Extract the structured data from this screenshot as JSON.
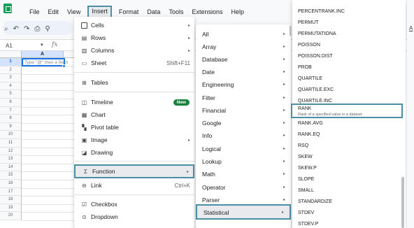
{
  "menubar": {
    "items": [
      "File",
      "Edit",
      "View",
      "Insert",
      "Format",
      "Data",
      "Tools",
      "Extensions",
      "Help"
    ],
    "active": "Insert"
  },
  "toolbar": {
    "icons": [
      "search-icon",
      "undo-icon",
      "redo-icon",
      "print-icon",
      "paint-format-icon"
    ],
    "glyphs": [
      "⌕",
      "↶",
      "↷",
      "⎙",
      "⚲"
    ],
    "right_label": "A"
  },
  "formula_bar": {
    "cell_ref": "A1",
    "dropdown_glyph": "▾",
    "fx_label": "fx"
  },
  "grid": {
    "column": "A",
    "rows": [
      "1",
      "2",
      "3",
      "4",
      "5",
      "6",
      "7",
      "8",
      "9",
      "10",
      "11",
      "12",
      "13",
      "14",
      "15",
      "16",
      "17",
      "18",
      "19",
      "20"
    ],
    "cell_hint": "Type \"@\" then a file n"
  },
  "insert_menu": {
    "items": [
      {
        "label": "Cells",
        "icon": "cells-icon",
        "glyph": "",
        "arrow": "▸"
      },
      {
        "label": "Rows",
        "icon": "rows-icon",
        "glyph": "▤",
        "arrow": "▸"
      },
      {
        "label": "Columns",
        "icon": "columns-icon",
        "glyph": "▥",
        "arrow": "▸"
      },
      {
        "label": "Sheet",
        "icon": "sheet-icon",
        "glyph": "▭",
        "shortcut": "Shift+F11"
      },
      {
        "label": "Tables",
        "icon": "tables-icon",
        "glyph": "⊞"
      },
      {
        "label": "Timeline",
        "icon": "timeline-icon",
        "glyph": "◫",
        "badge": "New"
      },
      {
        "label": "Chart",
        "icon": "chart-icon",
        "glyph": "▦"
      },
      {
        "label": "Pivot table",
        "icon": "pivot-table-icon",
        "glyph": "▚"
      },
      {
        "label": "Image",
        "icon": "image-icon",
        "glyph": "▣",
        "arrow": "▸"
      },
      {
        "label": "Drawing",
        "icon": "drawing-icon",
        "glyph": "◪"
      },
      {
        "label": "Function",
        "icon": "sigma-icon",
        "glyph": "Σ",
        "arrow": "▸"
      },
      {
        "label": "Link",
        "icon": "link-icon",
        "glyph": "⊖",
        "shortcut": "Ctrl+K"
      },
      {
        "label": "Checkbox",
        "icon": "checkbox-icon",
        "glyph": "☑"
      },
      {
        "label": "Dropdown",
        "icon": "dropdown-icon",
        "glyph": "⊙"
      }
    ],
    "highlighted": "Function"
  },
  "function_menu": {
    "items": [
      "All",
      "Array",
      "Database",
      "Date",
      "Engineering",
      "Filter",
      "Financial",
      "Google",
      "Info",
      "Logical",
      "Lookup",
      "Math",
      "Operator",
      "Parser",
      "Statistical"
    ],
    "arrow": "▸",
    "highlighted": "Statistical"
  },
  "statistical_menu": {
    "items": [
      "PERCENTRANK.INC",
      "PERMUT",
      "PERMUTATIONA",
      "POISSON",
      "POISSON.DIST",
      "PROB",
      "QUARTILE",
      "QUARTILE.EXC",
      "QUARTILE.INC",
      "RANK",
      "RANK.AVG",
      "RANK.EQ",
      "RSQ",
      "SKEW",
      "SKEW.P",
      "SLOPE",
      "SMALL",
      "STANDARDIZE",
      "STDEV",
      "STDEV.P"
    ],
    "highlighted": "RANK",
    "highlight_description": "Rank of a specified value in a dataset."
  },
  "colors": {
    "highlight_border": "#4a8fa3",
    "new_badge": "#188038",
    "selection_blue": "#1a73e8",
    "sheets_green": "#0f9d58"
  }
}
